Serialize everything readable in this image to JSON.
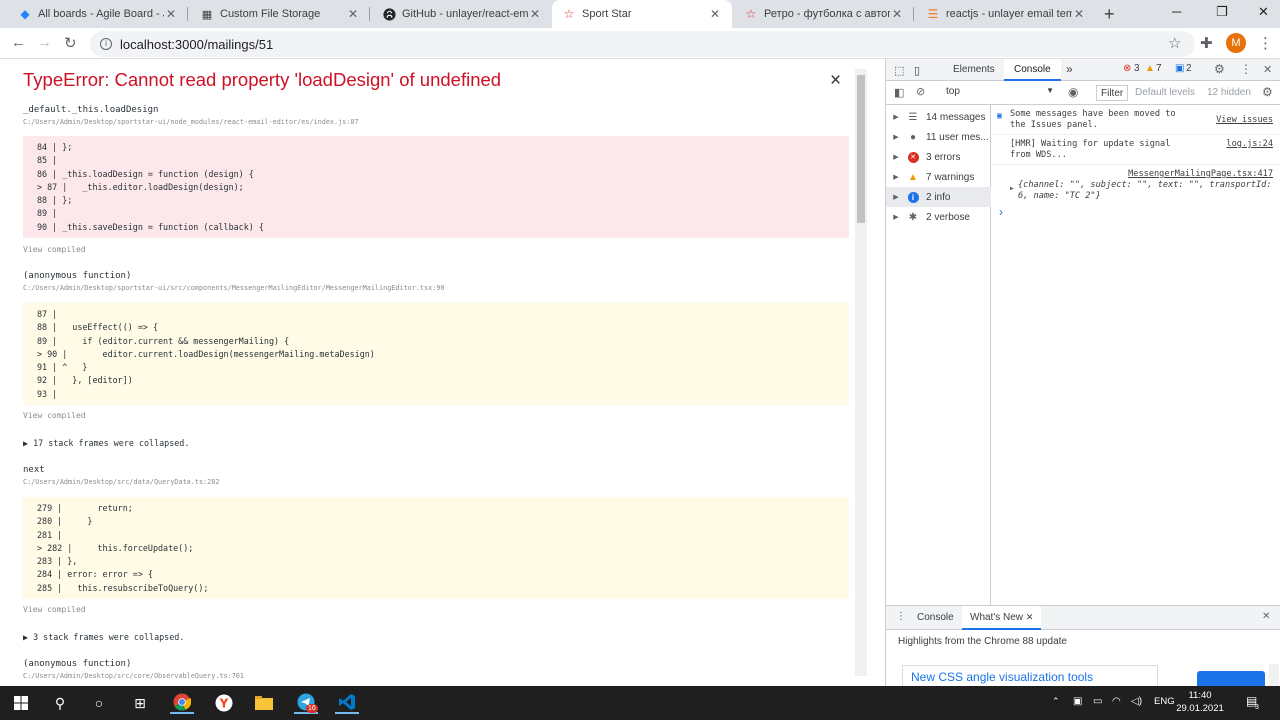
{
  "tabs": [
    {
      "title": "All boards - Agile Board - JIR",
      "icon": "jira-icon",
      "active": false
    },
    {
      "title": "Custom File Storage",
      "icon": "storage-icon",
      "active": false
    },
    {
      "title": "GitHub - unlayer/react-email",
      "icon": "github-icon",
      "active": false
    },
    {
      "title": "Sport Star",
      "icon": "star-icon",
      "active": true
    },
    {
      "title": "Ретро - футболка с автогра",
      "icon": "star-icon",
      "active": false
    },
    {
      "title": "reactjs - unlayer email templ",
      "icon": "stackoverflow-icon",
      "active": false
    }
  ],
  "address": {
    "url": "localhost:3000/mailings/51"
  },
  "profile": {
    "initial": "M",
    "color": "#e8710a"
  },
  "error": {
    "title": "TypeError: Cannot read property 'loadDesign' of undefined",
    "view_compiled": "View compiled",
    "frames": [
      {
        "fn": "_default._this.loadDesign",
        "path": "C:/Users/Admin/Desktop/sportstar-ui/node_modules/react-email-editor/es/index.js:87",
        "lines": [
          "84 | };",
          "85 |",
          "86 | _this.loadDesign = function (design) {",
          "> 87 |   _this.editor.loadDesign(design);",
          "88 | };",
          "89 |",
          "90 | _this.saveDesign = function (callback) {"
        ]
      },
      {
        "fn": "(anonymous function)",
        "path": "C:/Users/Admin/Desktop/sportstar-ui/src/components/MessengerMailingEditor/MessengerMailingEditor.tsx:90",
        "lines": [
          "87 |",
          "88 |   useEffect(() => {",
          "89 |     if (editor.current && messengerMailing) {",
          "> 90 |       editor.current.loadDesign(messengerMailing.metaDesign)",
          "91 | ^   }",
          "92 |   }, [editor])",
          "93 |"
        ]
      },
      {
        "fn": "next",
        "path": "C:/Users/Admin/Desktop/src/data/QueryData.ts:282",
        "lines": [
          "279 |       return;",
          "280 |     }",
          "281 |",
          "> 282 |     this.forceUpdate();",
          "283 | },",
          "284 | error: error => {",
          "285 |   this.resubscribeToQuery();"
        ]
      }
    ],
    "collapsed_1": "▶ 17 stack frames were collapsed.",
    "collapsed_2": "▶ 3 stack frames were collapsed.",
    "last_fn": "(anonymous function)",
    "last_path": "C:/Users/Admin/Desktop/src/core/ObservableQuery.ts:701"
  },
  "devtools": {
    "tab_elements": "Elements",
    "tab_console": "Console",
    "more_tabs": "»",
    "errors_count": "3",
    "warnings_count": "7",
    "info_count": "2",
    "context": "top",
    "filter_label": "Filter",
    "levels": "Default levels",
    "hidden": "12 hidden",
    "sidebar": [
      {
        "label": "14 messages",
        "icon": "list-icon"
      },
      {
        "label": "11 user mes...",
        "icon": "user-icon"
      },
      {
        "label": "3 errors",
        "icon": "error-icon"
      },
      {
        "label": "7 warnings",
        "icon": "warning-icon"
      },
      {
        "label": "2 info",
        "icon": "info-icon"
      },
      {
        "label": "2 verbose",
        "icon": "bug-icon"
      }
    ],
    "messages": [
      {
        "text": "Some messages have been moved to the Issues panel.",
        "link": "View issues"
      },
      {
        "text": "[HMR] Waiting for update signal from WDS...",
        "link": "log.js:24"
      },
      {
        "source": "MessengerMailingPage.tsx:417",
        "text": "{channel: \"\", subject: \"\", text: \"\", transportId: 6, name: \"TC 2\"}"
      }
    ],
    "prompt": "›",
    "drawer": {
      "tab_console": "Console",
      "tab_whats_new": "What's New",
      "highlights": "Highlights from the Chrome 88 update",
      "item": "New CSS angle visualization tools"
    }
  },
  "taskbar": {
    "lang": "ENG",
    "time": "11:40",
    "date": "29.01.2021",
    "telegram_badge": "16",
    "notif_count": "3"
  }
}
